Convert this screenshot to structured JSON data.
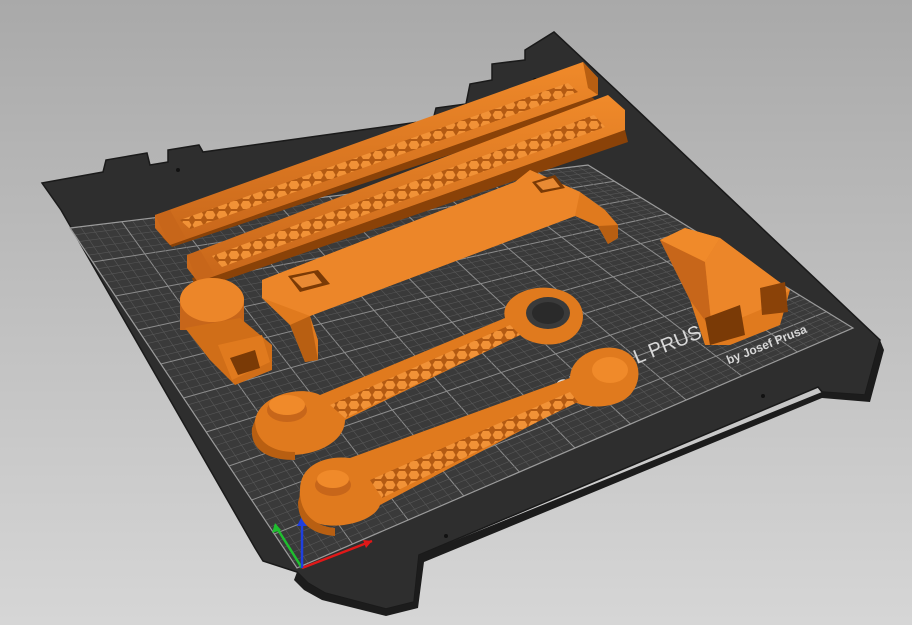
{
  "viewport": {
    "bed_label": "ORIGINAL PRUSA",
    "bed_sublabel": "by Josef Prusa",
    "colors": {
      "background_top": "#a9a9a9",
      "background_bottom": "#d6d6d6",
      "bed": "#2e2e2e",
      "bed_edge": "#1c1c1c",
      "grid_fine": "#5a5a5a",
      "grid_major": "#8c8c8c",
      "filament": "#e07a1e",
      "filament_shadow": "#b85f12",
      "filament_dark": "#8a4208",
      "axis_x": "#e01818",
      "axis_y": "#1fbf2f",
      "axis_z": "#1f3fdf"
    },
    "axes": {
      "x_icon": "x-axis-arrow",
      "y_icon": "y-axis-arrow",
      "z_icon": "z-axis-arrow"
    }
  },
  "objects": [
    {
      "name": "honeycomb-bar-1"
    },
    {
      "name": "honeycomb-bar-2"
    },
    {
      "name": "long-bracket"
    },
    {
      "name": "round-cap"
    },
    {
      "name": "tapered-socket"
    },
    {
      "name": "wrench-arm-1"
    },
    {
      "name": "wrench-arm-2"
    }
  ]
}
